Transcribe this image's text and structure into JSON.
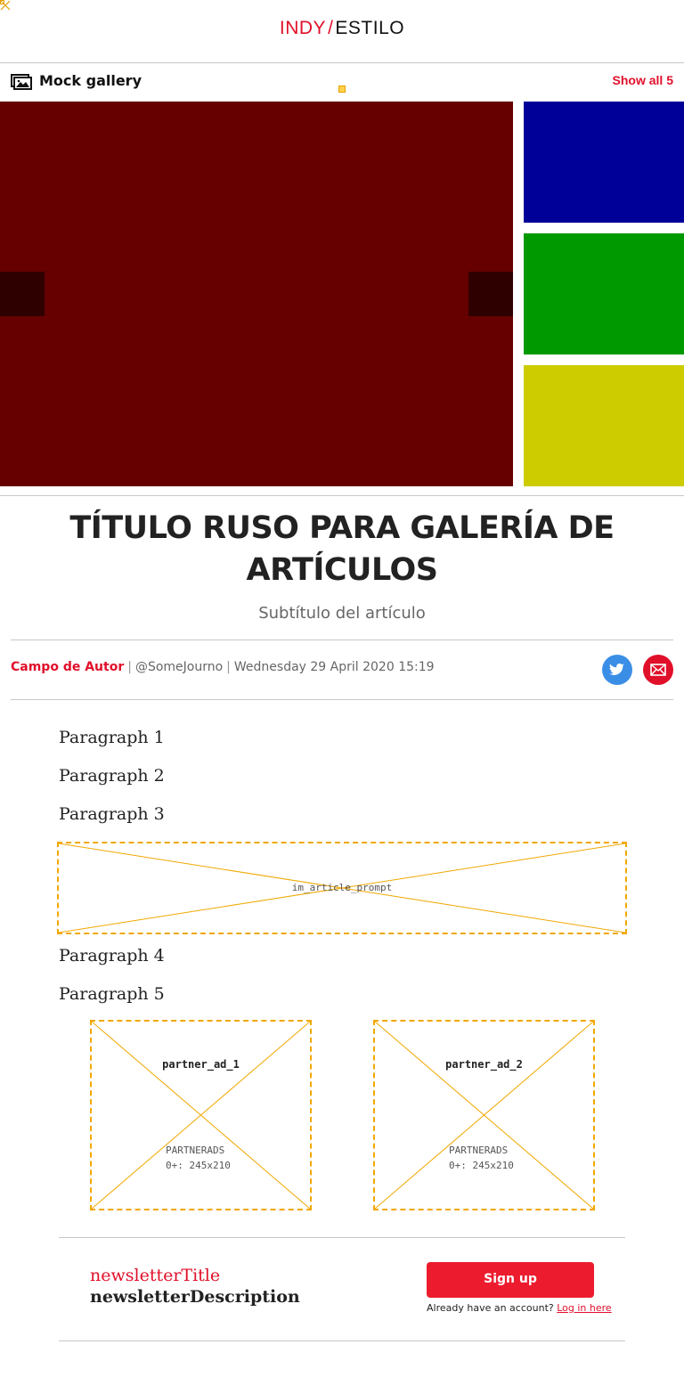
{
  "logo": {
    "part1": "INDY",
    "slash": "/",
    "part2": "ESTILO"
  },
  "gallery": {
    "title": "Mock gallery",
    "show_all": "Show all 5",
    "main_color": "#660000",
    "thumbs": [
      "#000099",
      "#009900",
      "#cccc00"
    ]
  },
  "article": {
    "headline": "TÍTULO RUSO PARA GALERÍA DE ARTÍCULOS",
    "subtitle": "Subtítulo del artículo",
    "author": "Campo de Autor",
    "handle": "@SomeJourno",
    "date": "Wednesday 29 April 2020 15:19",
    "paragraphs": [
      "Paragraph 1",
      "Paragraph 2",
      "Paragraph 3",
      "Paragraph 4",
      "Paragraph 5"
    ]
  },
  "ads": {
    "prompt": "im_article_prompt",
    "partner1": {
      "name": "partner_ad_1",
      "type": "PARTNERADS",
      "size": "0+: 245x210"
    },
    "partner2": {
      "name": "partner_ad_2",
      "type": "PARTNERADS",
      "size": "0+: 245x210"
    }
  },
  "newsletter": {
    "title": "newsletterTitle",
    "description": "newsletterDescription",
    "signup": "Sign up",
    "account_text": "Already have an account?",
    "login": "Log in here"
  },
  "colors": {
    "accent": "#e0102a",
    "twitter": "#3b8ee6",
    "email": "#e0102a",
    "ad_border": "#f0a800"
  }
}
